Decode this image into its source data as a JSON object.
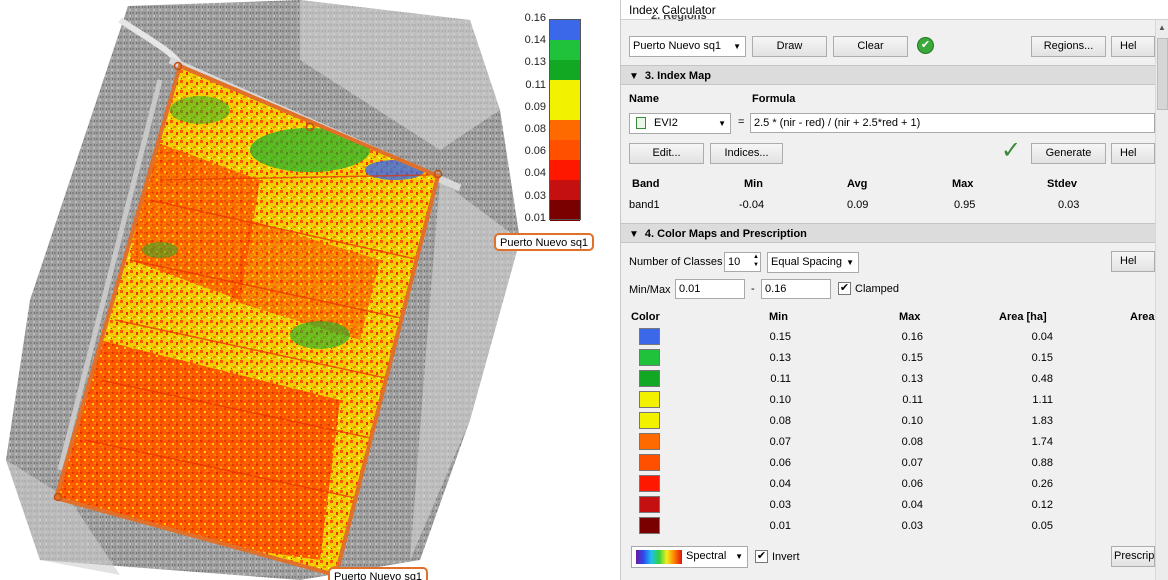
{
  "map": {
    "legend": [
      {
        "label": "0.16",
        "color": "#3a68e8"
      },
      {
        "label": "0.14",
        "color": "#1fc23a"
      },
      {
        "label": "0.13",
        "color": "#12a824"
      },
      {
        "label": "0.11",
        "color": "#f2f200"
      },
      {
        "label": "0.09",
        "color": "#f2f200"
      },
      {
        "label": "0.08",
        "color": "#ff6a00"
      },
      {
        "label": "0.06",
        "color": "#ff5000"
      },
      {
        "label": "0.04",
        "color": "#ff1800"
      },
      {
        "label": "0.03",
        "color": "#c41010"
      },
      {
        "label": "0.01",
        "color": "#7a0000"
      }
    ],
    "region_tag_1": "Puerto Nuevo sq1",
    "region_tag_2": "Puerto Nuevo sq1"
  },
  "panel": {
    "window_title": "Index Calculator",
    "regions": {
      "header_partial": "2. Regions",
      "region_select": "Puerto Nuevo sq1",
      "draw_label": "Draw",
      "clear_label": "Clear",
      "regions_label": "Regions...",
      "help_label": "Hel"
    },
    "index_map": {
      "section_title": "3. Index Map",
      "name_header": "Name",
      "formula_header": "Formula",
      "index_select": "EVI2",
      "equals": "=",
      "formula": "2.5 * (nir - red) / (nir + 2.5*red + 1)",
      "edit_label": "Edit...",
      "indices_label": "Indices...",
      "generate_label": "Generate",
      "help_label": "Hel",
      "stats_headers": [
        "Band",
        "Min",
        "Avg",
        "Max",
        "Stdev"
      ],
      "stats_row": [
        "band1",
        "-0.04",
        "0.09",
        "0.95",
        "0.03"
      ]
    },
    "color_maps": {
      "section_title": "4. Color Maps and Prescription",
      "num_classes_label": "Number of Classes",
      "num_classes_value": "10",
      "spacing_select": "Equal Spacing",
      "help_label": "Hel",
      "minmax_label": "Min/Max",
      "min_value": "0.01",
      "dash": "-",
      "max_value": "0.16",
      "clamped_label": "Clamped",
      "clamped_checked": "✔",
      "table_headers": [
        "Color",
        "Min",
        "Max",
        "Area [ha]",
        "Area"
      ],
      "rows": [
        {
          "color": "#3a68e8",
          "min": "0.15",
          "max": "0.16",
          "area": "0.04"
        },
        {
          "color": "#1fc23a",
          "min": "0.13",
          "max": "0.15",
          "area": "0.15"
        },
        {
          "color": "#12a824",
          "min": "0.11",
          "max": "0.13",
          "area": "0.48"
        },
        {
          "color": "#f2f200",
          "min": "0.10",
          "max": "0.11",
          "area": "1.11"
        },
        {
          "color": "#f2f200",
          "min": "0.08",
          "max": "0.10",
          "area": "1.83"
        },
        {
          "color": "#ff6a00",
          "min": "0.07",
          "max": "0.08",
          "area": "1.74"
        },
        {
          "color": "#ff5000",
          "min": "0.06",
          "max": "0.07",
          "area": "0.88"
        },
        {
          "color": "#ff1800",
          "min": "0.04",
          "max": "0.06",
          "area": "0.26"
        },
        {
          "color": "#c41010",
          "min": "0.03",
          "max": "0.04",
          "area": "0.12"
        },
        {
          "color": "#7a0000",
          "min": "0.01",
          "max": "0.03",
          "area": "0.05"
        }
      ],
      "palette_select": "Spectral",
      "invert_label": "Invert",
      "invert_checked": "✔",
      "prescription_label": "Prescrip"
    }
  }
}
